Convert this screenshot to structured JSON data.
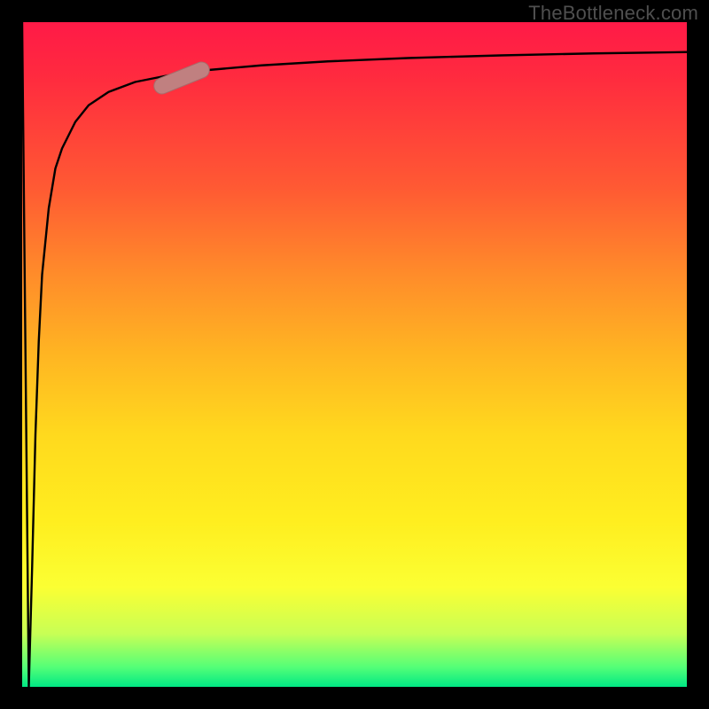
{
  "watermark": {
    "text": "TheBottleneck.com"
  },
  "colors": {
    "black": "#000000",
    "curve": "#000000",
    "marker_fill": "#c08080",
    "marker_stroke": "#a86a6a",
    "gradient_top": "#ff1a47",
    "gradient_mid": "#ffd91e",
    "gradient_bottom": "#00e884"
  },
  "chart_data": {
    "type": "line",
    "title": "",
    "xlabel": "",
    "ylabel": "",
    "xlim": [
      0,
      100
    ],
    "ylim": [
      0,
      100
    ],
    "grid": false,
    "background": "vertical_gradient_red_to_green",
    "series": [
      {
        "name": "bottleneck-curve",
        "x": [
          0,
          1,
          1.5,
          2,
          2.5,
          3,
          4,
          5,
          6,
          8,
          10,
          13,
          17,
          22,
          28,
          36,
          46,
          58,
          72,
          86,
          100
        ],
        "y": [
          100,
          0,
          18,
          38,
          52,
          62,
          72,
          78,
          81,
          85,
          87.5,
          89.5,
          91,
          92,
          92.8,
          93.5,
          94.1,
          94.6,
          95.0,
          95.3,
          95.5
        ]
      }
    ],
    "marker": {
      "series": "bottleneck-curve",
      "x": 24,
      "y": 91.6,
      "shape": "rounded-pill",
      "angle_deg": -22
    }
  }
}
